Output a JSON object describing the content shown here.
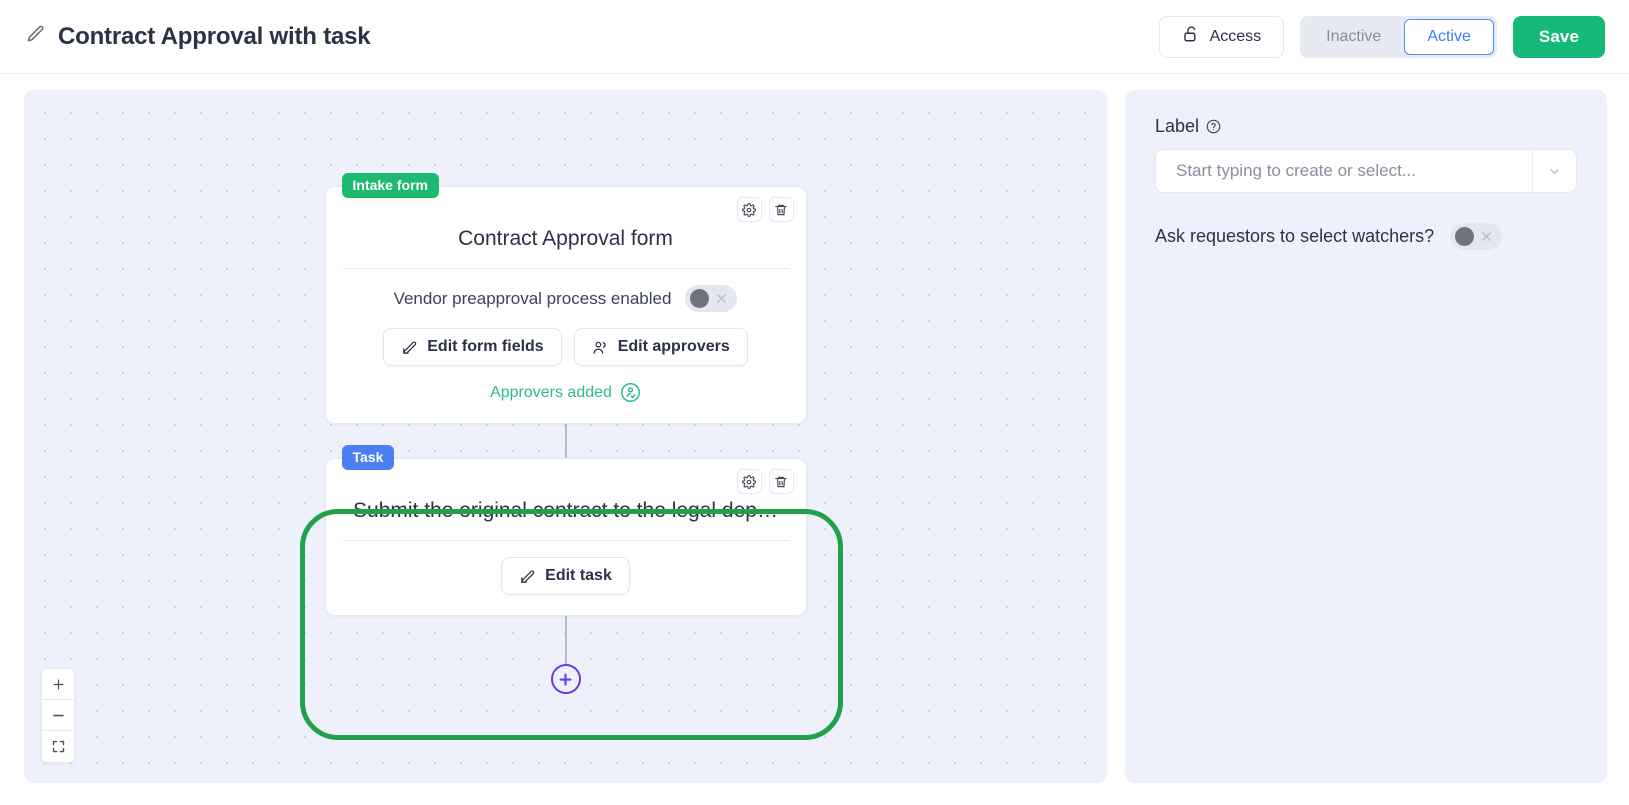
{
  "header": {
    "edit_icon": "pencil-icon",
    "title": "Contract Approval with task",
    "access_label": "Access",
    "access_icon": "unlock-icon",
    "status_options": [
      "Inactive",
      "Active"
    ],
    "status_inactive": "Inactive",
    "status_active": "Active",
    "selected_status": "Active",
    "save_label": "Save",
    "accent_green": "#17b978",
    "accent_blue": "#3c7ef0"
  },
  "canvas": {
    "annotation_color": "#22a148",
    "nodes": [
      {
        "badge": "Intake form",
        "badge_color": "#1cb96f",
        "title": "Contract Approval form",
        "toggle_label": "Vendor preapproval process enabled",
        "toggle_state": "off",
        "buttons": [
          {
            "label": "Edit form fields",
            "icon": "edit-pencil-icon"
          },
          {
            "label": "Edit approvers",
            "icon": "users-icon"
          }
        ],
        "status_text": "Approvers added",
        "status_icon": "user-check-circle-icon",
        "status_color": "#2dbd84",
        "tools": [
          "gear-icon",
          "trash-icon"
        ]
      },
      {
        "badge": "Task",
        "badge_color": "#4a7ef2",
        "title": "Submit the original contract to the legal dep…",
        "buttons": [
          {
            "label": "Edit task",
            "icon": "edit-pencil-icon"
          }
        ],
        "tools": [
          "gear-icon",
          "trash-icon"
        ]
      }
    ],
    "add_node_icon": "plus-circle-icon",
    "add_node_color": "#6a36f0",
    "zoom_controls": [
      {
        "name": "zoom-in",
        "icon": "plus-icon"
      },
      {
        "name": "zoom-out",
        "icon": "minus-icon"
      },
      {
        "name": "fit-view",
        "icon": "expand-icon"
      }
    ]
  },
  "panel": {
    "label_field": {
      "label": "Label",
      "help_icon": "question-circle-icon",
      "placeholder": "Start typing to create or select...",
      "value": "",
      "arrow_icon": "chevron-down-icon"
    },
    "watchers": {
      "label": "Ask requestors to select watchers?",
      "toggle_state": "off"
    }
  }
}
